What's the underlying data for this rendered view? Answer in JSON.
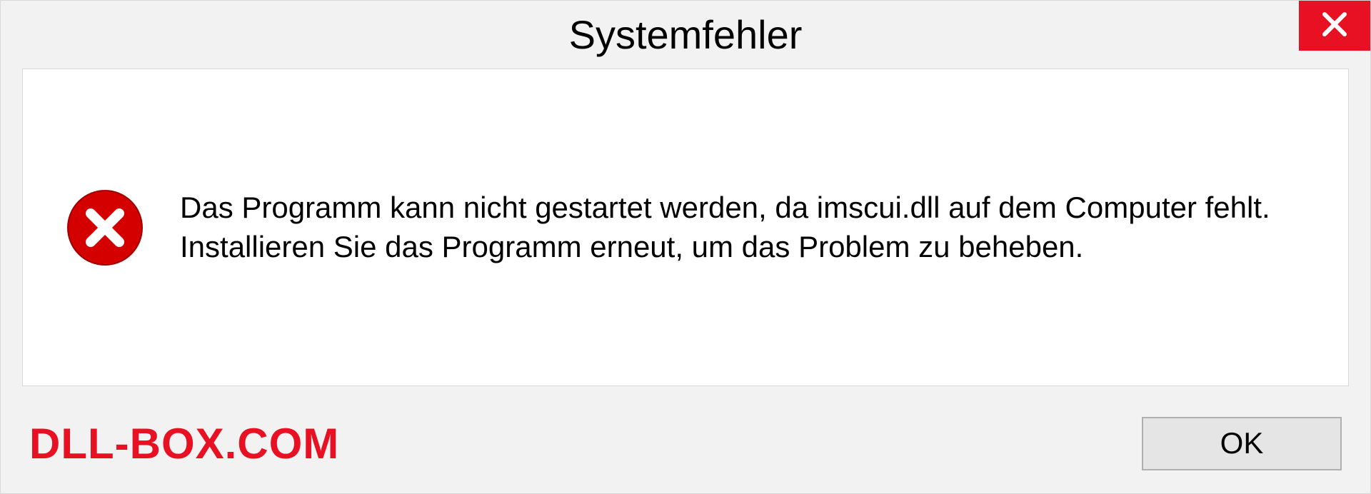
{
  "dialog": {
    "title": "Systemfehler",
    "message": "Das Programm kann nicht gestartet werden, da imscui.dll auf dem Computer fehlt. Installieren Sie das Programm erneut, um das Problem zu beheben.",
    "ok_label": "OK"
  },
  "watermark": "DLL-BOX.COM",
  "colors": {
    "close_red": "#e81123",
    "error_red": "#d40000",
    "watermark_red": "#e81123"
  }
}
